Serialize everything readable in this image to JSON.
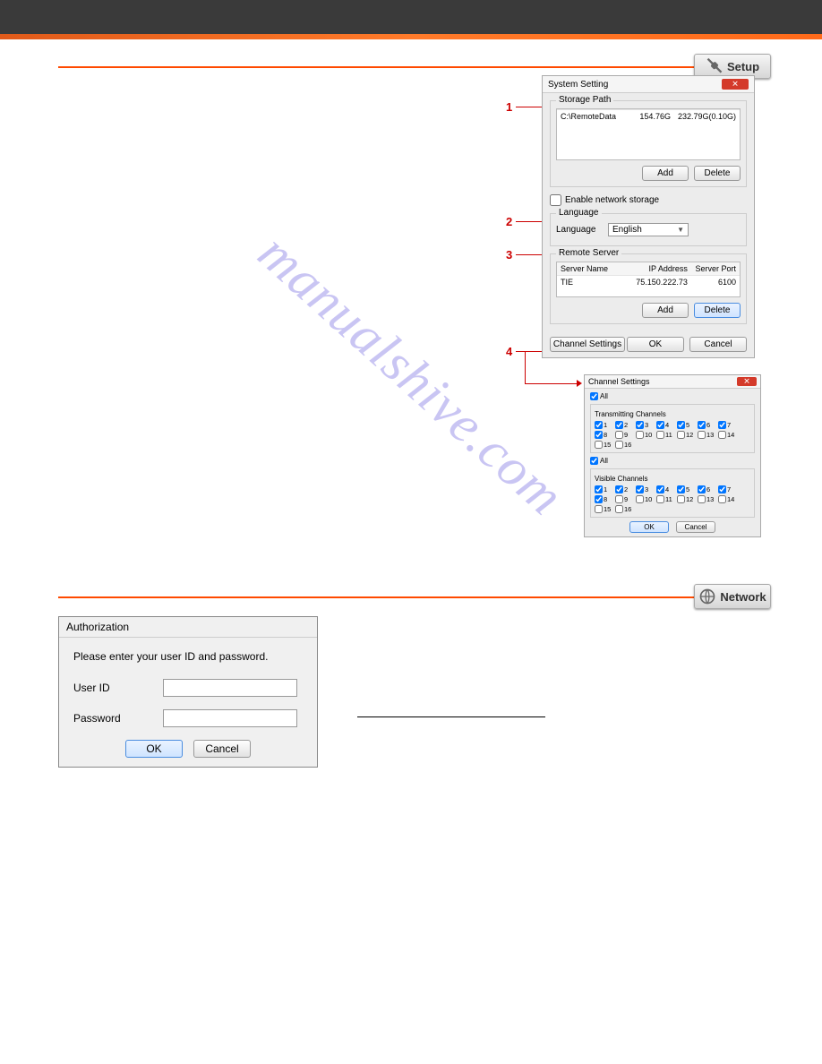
{
  "badges": {
    "setup": "Setup",
    "network": "Network"
  },
  "callouts": {
    "c1": "1",
    "c2": "2",
    "c3": "3",
    "c4": "4"
  },
  "system_setting": {
    "title": "System Setting",
    "storage": {
      "label": "Storage Path",
      "row": {
        "path": "C:\\RemoteData",
        "free": "154.76G",
        "total": "232.79G(0.10G)"
      },
      "add": "Add",
      "delete": "Delete",
      "enable_net": "Enable network storage"
    },
    "language": {
      "group": "Language",
      "label": "Language",
      "value": "English"
    },
    "remote": {
      "group": "Remote Server",
      "head": {
        "name": "Server Name",
        "ip": "IP Address",
        "port": "Server Port"
      },
      "row": {
        "name": "TIE",
        "ip": "75.150.222.73",
        "port": "6100"
      },
      "add": "Add",
      "delete": "Delete"
    },
    "footer": {
      "channel": "Channel Settings",
      "ok": "OK",
      "cancel": "Cancel"
    }
  },
  "channel_settings": {
    "title": "Channel Settings",
    "all": "All",
    "transmitting": "Transmitting Channels",
    "visible": "Visible Channels",
    "checked_tx": [
      1,
      2,
      3,
      4,
      5,
      6,
      7,
      8
    ],
    "checked_vis": [
      1,
      2,
      3,
      4,
      5,
      6,
      7,
      8
    ],
    "ok": "OK",
    "cancel": "Cancel"
  },
  "authorization": {
    "title": "Authorization",
    "prompt": "Please enter your user ID and password.",
    "user_label": "User ID",
    "pass_label": "Password",
    "ok": "OK",
    "cancel": "Cancel"
  },
  "watermark": "manualshive.com"
}
